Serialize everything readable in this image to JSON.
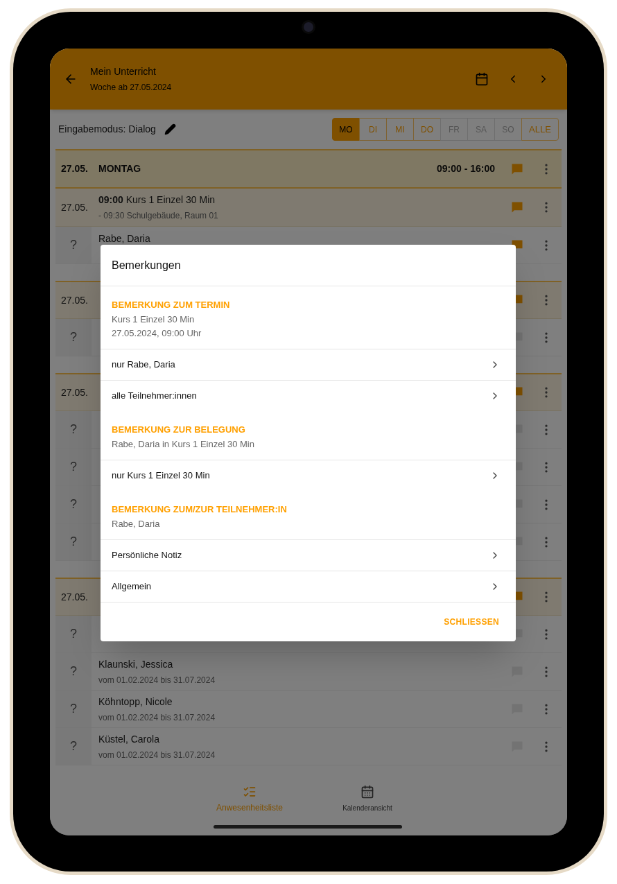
{
  "header": {
    "title": "Mein Unterricht",
    "subtitle": "Woche ab 27.05.2024"
  },
  "toolbar": {
    "mode_label": "Eingabemodus: Dialog",
    "days": [
      {
        "label": "MO",
        "selected": true,
        "disabled": false
      },
      {
        "label": "DI",
        "selected": false,
        "disabled": false
      },
      {
        "label": "MI",
        "selected": false,
        "disabled": false
      },
      {
        "label": "DO",
        "selected": false,
        "disabled": false
      },
      {
        "label": "FR",
        "selected": false,
        "disabled": true
      },
      {
        "label": "SA",
        "selected": false,
        "disabled": true
      },
      {
        "label": "SO",
        "selected": false,
        "disabled": true
      },
      {
        "label": "ALLE",
        "selected": false,
        "disabled": false
      }
    ]
  },
  "day": {
    "date": "27.05.",
    "title": "MONTAG",
    "time": "09:00 - 16:00",
    "has_comment": true
  },
  "courses": [
    {
      "date": "27.05.",
      "title": "**09:00** Kurs 1 Einzel 30 Min",
      "location": "- 09:30 Schulgebäude, Raum 01",
      "has_comment": true,
      "participants": [
        {
          "status": "?",
          "name": "Rabe, Daria",
          "has_comment": true
        }
      ]
    },
    {
      "date": "27.05.",
      "has_comment": true,
      "participants": [
        {
          "status": "?",
          "has_comment": false
        }
      ]
    },
    {
      "date": "27.05.",
      "has_comment": true,
      "participants": [
        {
          "status": "?",
          "has_comment": false
        },
        {
          "status": "?",
          "has_comment": false
        },
        {
          "status": "?",
          "has_comment": false
        },
        {
          "status": "?",
          "has_comment": false
        }
      ]
    },
    {
      "date": "27.05.",
      "has_comment": true,
      "participants": [
        {
          "status": "?",
          "has_comment": false
        },
        {
          "status": "?",
          "name": "Klaunski, Jessica",
          "dates": "vom 01.02.2024 bis 31.07.2024",
          "has_comment": false
        },
        {
          "status": "?",
          "name": "Köhntopp, Nicole",
          "dates": "vom 01.02.2024 bis 31.07.2024",
          "has_comment": false
        },
        {
          "status": "?",
          "name": "Küstel, Carola",
          "dates": "vom 01.02.2024 bis 31.07.2024",
          "has_comment": false
        }
      ]
    }
  ],
  "bottom_nav": [
    {
      "label": "Anwesenheitsliste",
      "selected": true,
      "kind": "checklist"
    },
    {
      "label": "Kalenderansicht",
      "selected": false,
      "kind": "calendar"
    }
  ],
  "dialog": {
    "title": "Bemerkungen",
    "sections": [
      {
        "heading": "BEMERKUNG ZUM TERMIN",
        "lines": [
          "Kurs 1 Einzel 30 Min",
          "27.05.2024, 09:00 Uhr"
        ],
        "options": [
          "nur Rabe, Daria",
          "alle Teilnehmer:innen"
        ]
      },
      {
        "heading": "BEMERKUNG ZUR BELEGUNG",
        "lines": [
          "Rabe, Daria in Kurs 1 Einzel 30 Min"
        ],
        "options": [
          "nur Kurs 1 Einzel 30 Min"
        ]
      },
      {
        "heading": "BEMERKUNG ZUM/ZUR TEILNEHMER:IN",
        "lines": [
          "Rabe, Daria"
        ],
        "options": [
          "Persönliche Notiz",
          "Allgemein"
        ]
      }
    ],
    "close_button": "SCHLIESSEN"
  }
}
